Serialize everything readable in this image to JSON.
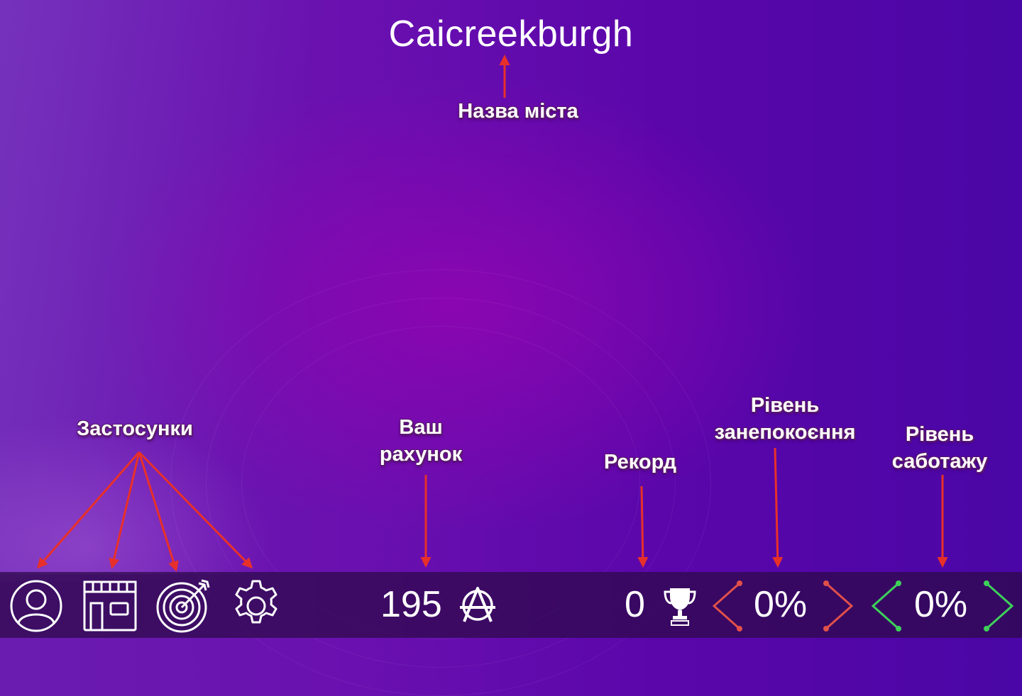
{
  "city_name": "Caicreekburgh",
  "annotations": {
    "city_name": "Назва міста",
    "apps": "Застосунки",
    "score": [
      "Ваш",
      "рахунок"
    ],
    "record": "Рекорд",
    "concern": [
      "Рівень",
      "занепокоєння"
    ],
    "sabotage": [
      "Рівень",
      "саботажу"
    ]
  },
  "bottom_bar": {
    "apps": [
      {
        "name": "profile",
        "icon": "user-icon"
      },
      {
        "name": "shop",
        "icon": "store-icon"
      },
      {
        "name": "targets",
        "icon": "target-icon"
      },
      {
        "name": "settings",
        "icon": "gear-icon"
      }
    ],
    "score": "195",
    "score_icon": "anarchy-icon",
    "record": "0",
    "record_icon": "trophy-icon",
    "concern_level": "0%",
    "concern_color": "#e0504a",
    "sabotage_level": "0%",
    "sabotage_color": "#3ed15a"
  },
  "colors": {
    "annotation_arrow": "#e8302a",
    "background_left": "#6a1cb0",
    "background_right": "#4a06a6"
  }
}
